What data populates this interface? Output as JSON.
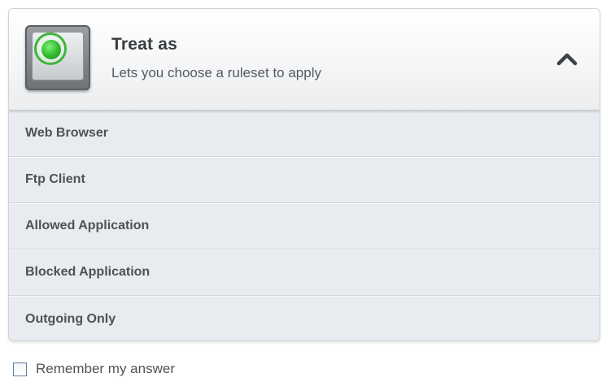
{
  "header": {
    "title": "Treat as",
    "subtitle": "Lets you choose a ruleset to apply",
    "icon": "green-radio-status-icon",
    "collapse_icon": "chevron-up-icon"
  },
  "options": [
    {
      "label": "Web Browser"
    },
    {
      "label": "Ftp Client"
    },
    {
      "label": "Allowed Application"
    },
    {
      "label": "Blocked Application"
    },
    {
      "label": "Outgoing Only"
    }
  ],
  "remember": {
    "label": "Remember my answer",
    "checked": false
  },
  "colors": {
    "accent_green": "#2fb82a",
    "panel_bg": "#e8ecf1",
    "text": "#4d5256"
  }
}
